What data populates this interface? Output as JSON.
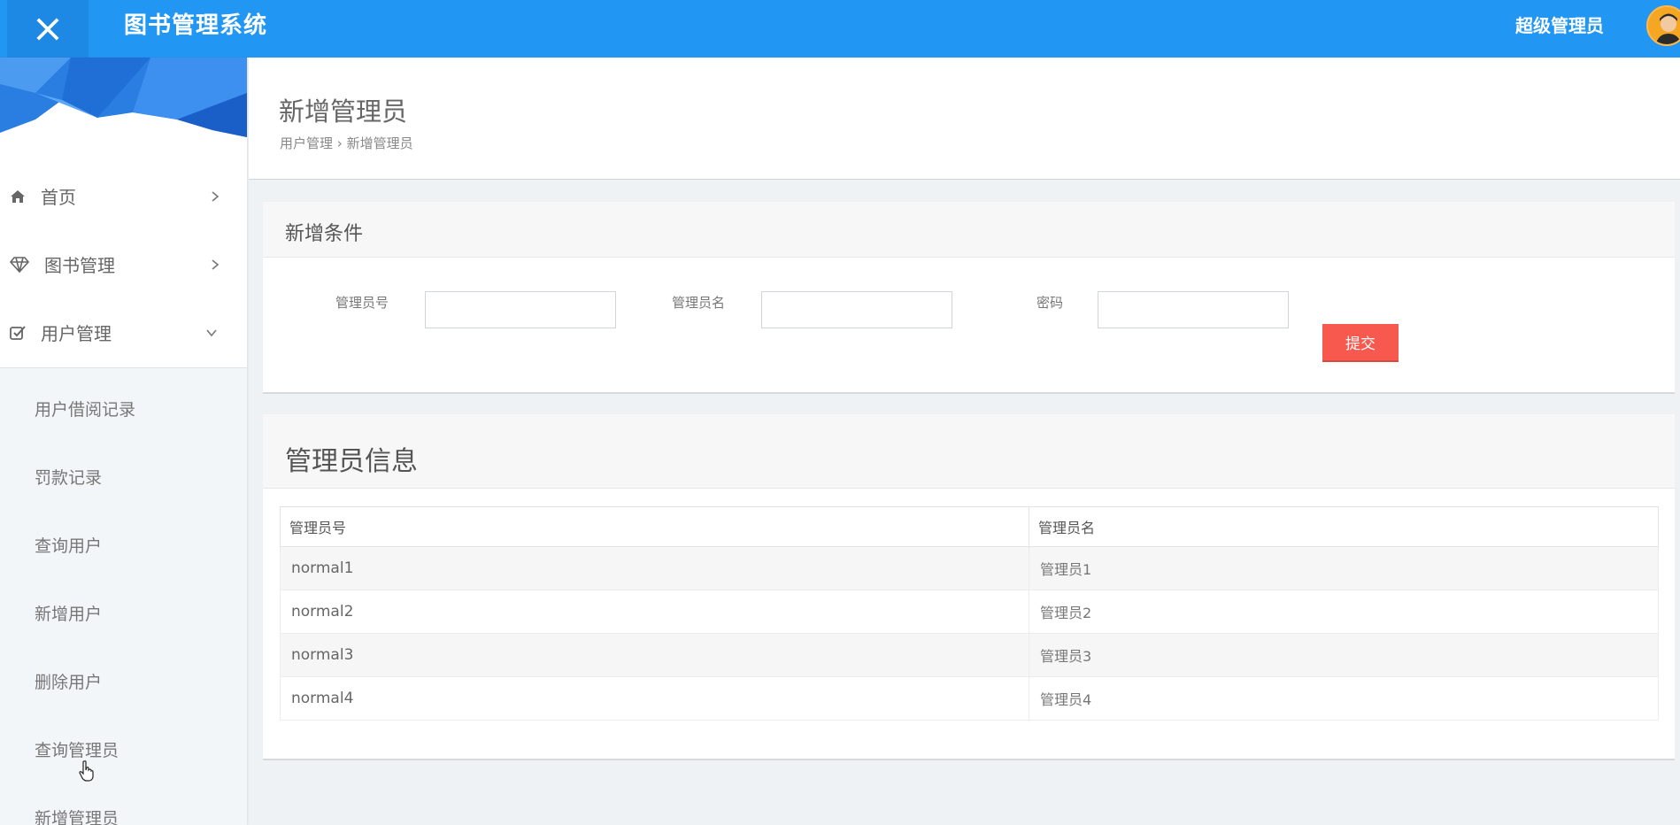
{
  "header": {
    "brand": "图书管理系统",
    "user_name": "超级管理员",
    "colors": {
      "topbar": "#2196f3",
      "toggle": "#1e88e5",
      "avatar": "#f5a623"
    }
  },
  "sidebar": {
    "menu": [
      {
        "label": "首页",
        "icon": "home-icon",
        "arrow": "chevron-right-icon"
      },
      {
        "label": "图书管理",
        "icon": "diamond-icon",
        "arrow": "chevron-right-icon"
      },
      {
        "label": "用户管理",
        "icon": "check-square-icon",
        "arrow": "chevron-down-icon"
      }
    ],
    "submenu": [
      {
        "label": "用户借阅记录"
      },
      {
        "label": "罚款记录"
      },
      {
        "label": "查询用户"
      },
      {
        "label": "新增用户"
      },
      {
        "label": "删除用户"
      },
      {
        "label": "查询管理员"
      },
      {
        "label": "新增管理员"
      }
    ]
  },
  "page": {
    "title": "新增管理员",
    "breadcrumb": {
      "parent": "用户管理",
      "separator": "›",
      "current": "新增管理员"
    }
  },
  "form_panel": {
    "title": "新增条件",
    "fields": [
      {
        "label": "管理员号",
        "value": "",
        "placeholder": ""
      },
      {
        "label": "管理员名",
        "value": "",
        "placeholder": ""
      },
      {
        "label": "密码",
        "value": "",
        "placeholder": ""
      }
    ],
    "submit_label": "提交",
    "submit_color": "#f7594f"
  },
  "table_panel": {
    "title": "管理员信息",
    "columns": [
      "管理员号",
      "管理员名"
    ],
    "rows": [
      [
        "normal1",
        "管理员1"
      ],
      [
        "normal2",
        "管理员2"
      ],
      [
        "normal3",
        "管理员3"
      ],
      [
        "normal4",
        "管理员4"
      ]
    ]
  }
}
